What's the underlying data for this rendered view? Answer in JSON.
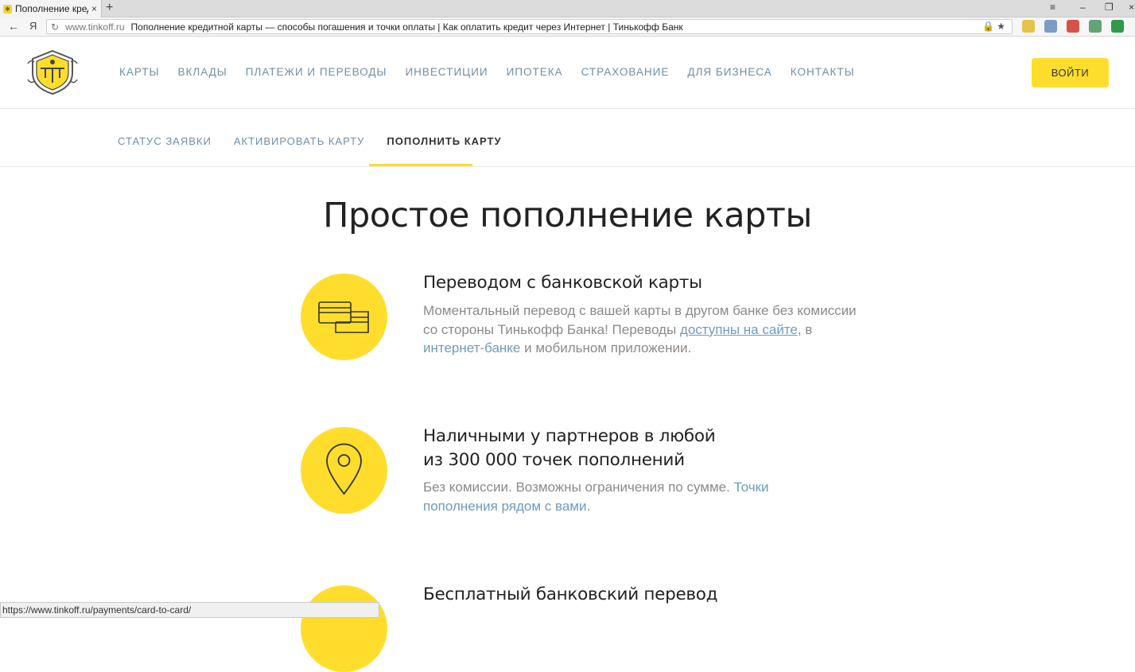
{
  "browser": {
    "tab_title": "Пополнение кредитной карты — способы погашения и точки оплаты",
    "tab_favicon_glyph": "✱",
    "new_tab": "+",
    "close_glyph": "×",
    "address": {
      "domain": "www.tinkoff.ru",
      "page_title": "Пополнение кредитной карты — способы погашения и точки оплаты | Как оплатить кредит через Интернет | Тинькофф Банк"
    },
    "nav": {
      "back": "←",
      "ya": "Я",
      "reload": "↻"
    },
    "addr_icons": "🔒 ★",
    "window_controls": {
      "menu": "≡",
      "minimize": "–",
      "restore": "❐",
      "close": "×"
    },
    "status_url": "https://www.tinkoff.ru/payments/card-to-card/"
  },
  "header": {
    "nav": [
      "КАРТЫ",
      "ВКЛАДЫ",
      "ПЛАТЕЖИ И ПЕРЕВОДЫ",
      "ИНВЕСТИЦИИ",
      "ИПОТЕКА",
      "СТРАХОВАНИЕ",
      "ДЛЯ БИЗНЕСА",
      "КОНТАКТЫ"
    ],
    "login": "ВОЙТИ"
  },
  "subnav": {
    "items": [
      "СТАТУС ЗАЯВКИ",
      "АКТИВИРОВАТЬ КАРТУ",
      "ПОПОЛНИТЬ КАРТУ"
    ],
    "active_index": 2
  },
  "main": {
    "title": "Простое пополнение карты",
    "items": [
      {
        "title": "Переводом с банковской карты",
        "text1": "Моментальный перевод с вашей карты в другом банке без комиссии со стороны Тинькофф Банка! Переводы ",
        "link1": "доступны на сайте",
        "text2": ", в ",
        "link2": "интернет-банке",
        "text3": " и мобильном приложении."
      },
      {
        "title_line1": "Наличными у партнеров в любой",
        "title_line2": "из 300 000 точек пополнений",
        "text1": "Без комиссии. Возможны ограничения по сумме. ",
        "link1": "Точки пополнения рядом с вами",
        "text2": "."
      },
      {
        "title": "Бесплатный банковский перевод"
      }
    ]
  },
  "colors": {
    "accent": "#ffdd2d",
    "link": "#6e8fa8",
    "text_muted": "#8a8a8a"
  }
}
